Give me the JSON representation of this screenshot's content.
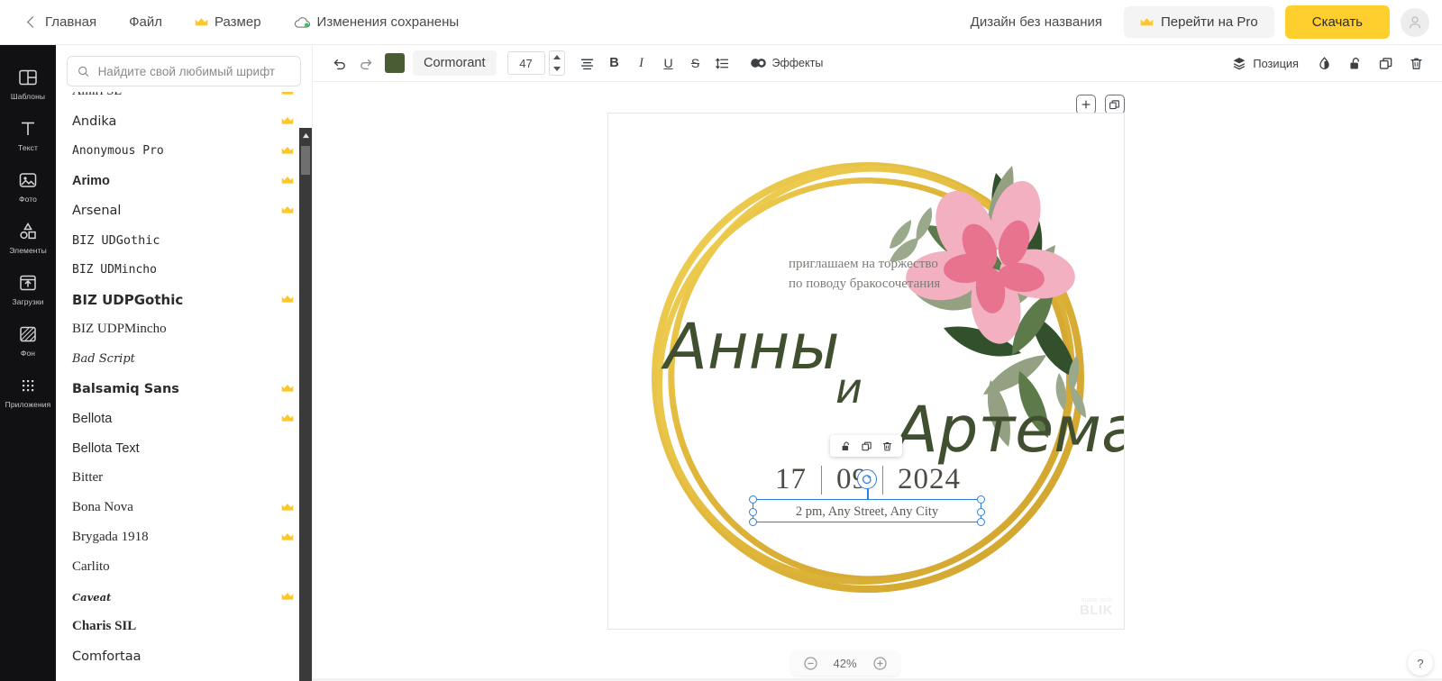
{
  "topbar": {
    "back_label": "Главная",
    "file_label": "Файл",
    "size_label": "Размер",
    "saved_label": "Изменения сохранены",
    "doc_title": "Дизайн без названия",
    "pro_label": "Перейти на Pro",
    "download_label": "Скачать"
  },
  "rail": {
    "items": [
      {
        "label": "Шаблоны",
        "icon": "templates-icon"
      },
      {
        "label": "Текст",
        "icon": "text-icon"
      },
      {
        "label": "Фото",
        "icon": "photo-icon"
      },
      {
        "label": "Элементы",
        "icon": "elements-icon"
      },
      {
        "label": "Загрузки",
        "icon": "uploads-icon"
      },
      {
        "label": "Фон",
        "icon": "background-icon"
      },
      {
        "label": "Приложения",
        "icon": "apps-icon"
      }
    ]
  },
  "panel": {
    "search_placeholder": "Найдите свой любимый шрифт",
    "search_value": "",
    "fonts": [
      {
        "name": "Amiri SL",
        "pro": true
      },
      {
        "name": "Andika",
        "pro": true
      },
      {
        "name": "Anonymous Pro",
        "pro": true
      },
      {
        "name": "Arimo",
        "pro": true
      },
      {
        "name": "Arsenal",
        "pro": true
      },
      {
        "name": "BIZ UDGothic",
        "pro": false
      },
      {
        "name": "BIZ UDMincho",
        "pro": false
      },
      {
        "name": "BIZ UDPGothic",
        "pro": true
      },
      {
        "name": "BIZ UDPMincho",
        "pro": false
      },
      {
        "name": "Bad Script",
        "pro": false
      },
      {
        "name": "Balsamiq Sans",
        "pro": true
      },
      {
        "name": "Bellota",
        "pro": true
      },
      {
        "name": "Bellota Text",
        "pro": false
      },
      {
        "name": "Bitter",
        "pro": false
      },
      {
        "name": "Bona Nova",
        "pro": true
      },
      {
        "name": "Brygada 1918",
        "pro": true
      },
      {
        "name": "Carlito",
        "pro": false
      },
      {
        "name": "Caveat",
        "pro": true
      },
      {
        "name": "Charis SIL",
        "pro": false
      },
      {
        "name": "Comfortaa",
        "pro": false
      }
    ]
  },
  "toolbar": {
    "color_swatch": "#4a5c34",
    "font_family": "Cormorant",
    "font_size": "47",
    "bold_label": "B",
    "italic_label": "I",
    "underline_label": "U",
    "strike_label": "S",
    "effects_label": "Эффекты",
    "position_label": "Позиция"
  },
  "canvas": {
    "zoom_level": "42%",
    "help_label": "?",
    "watermark_line1": "made with",
    "watermark_line2": "BLIK",
    "design": {
      "invite_line1": "приглашаем на торжество",
      "invite_line2": "по поводу бракосочетания",
      "name_first": "Анны",
      "conjunction": "и",
      "name_second": "Артема",
      "date_day": "17",
      "date_month": "09",
      "date_year": "2024",
      "address": "2 pm, Any Street, Any City",
      "text_color": "#3f4f30",
      "accent_gold": "#e8c44a",
      "flower_pink": "#f0a3b4"
    }
  }
}
